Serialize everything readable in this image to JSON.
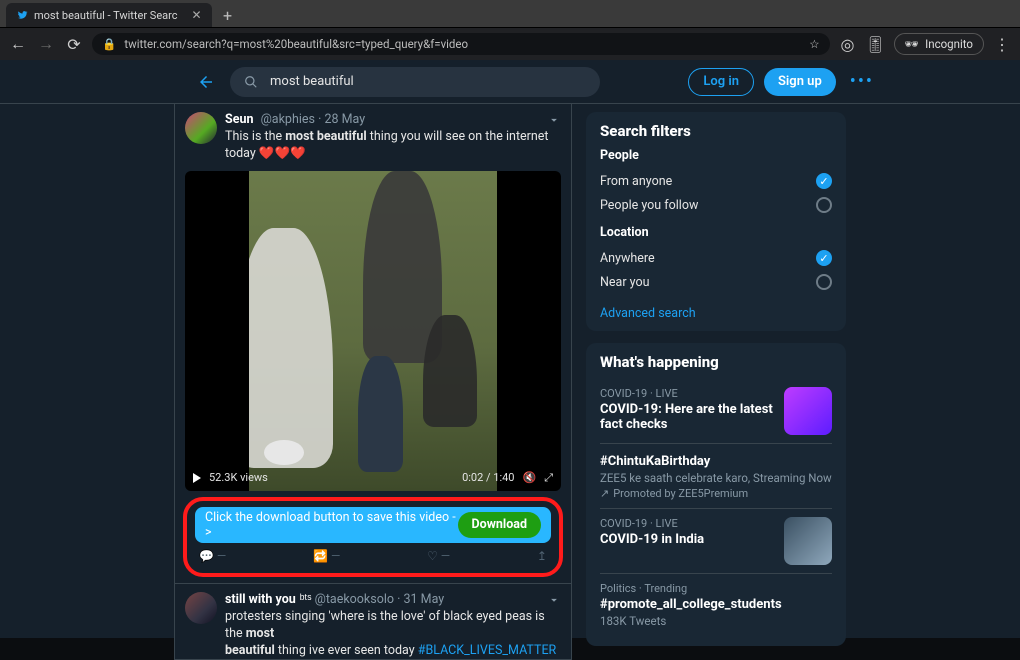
{
  "browser": {
    "tab_title": "most beautiful - Twitter Searc",
    "url_display": "twitter.com/search?q=most%20beautiful&src=typed_query&f=video",
    "incognito_label": "Incognito"
  },
  "topbar": {
    "search_value": "most beautiful",
    "login": "Log in",
    "signup": "Sign up"
  },
  "tweet1": {
    "name": "Seun",
    "handle": "@akphies",
    "date": "28 May",
    "text_pre": "This is the ",
    "text_bold": "most beautiful",
    "text_post": " thing you will see on the internet today ",
    "hearts": "❤️❤️❤️",
    "views": "52.3K views",
    "time": "0:02 / 1:40"
  },
  "download_bar": {
    "cta_text": "Click the download button to save this video ->",
    "btn": "Download"
  },
  "tweet2": {
    "name": "still with you",
    "badge": "ᵇᵗˢ",
    "handle": "@taekooksolo",
    "date": "31 May",
    "line1_pre": "protesters singing 'where is the love' of black eyed peas is the ",
    "line1_bold": "most",
    "line2_bold": "beautiful",
    "line2_post": " thing ive ever seen today ",
    "hashtag": "#BLACK_LIVES_MATTER"
  },
  "filters": {
    "heading": "Search filters",
    "people_label": "People",
    "people_any": "From anyone",
    "people_follow": "People you follow",
    "loc_label": "Location",
    "loc_any": "Anywhere",
    "loc_near": "Near you",
    "advanced": "Advanced search"
  },
  "happening": {
    "heading": "What's happening",
    "items": [
      {
        "cat": "COVID-19 · LIVE",
        "title": "COVID-19: Here are the latest fact checks",
        "thumb": "a"
      },
      {
        "title": "#ChintuKaBirthday",
        "desc": "ZEE5 ke saath celebrate karo, Streaming Now",
        "promoted": "Promoted by ZEE5Premium"
      },
      {
        "cat": "COVID-19 · LIVE",
        "title": "COVID-19 in India",
        "thumb": "b"
      },
      {
        "cat": "Politics · Trending",
        "title": "#promote_all_college_students",
        "desc": "183K Tweets"
      }
    ]
  }
}
